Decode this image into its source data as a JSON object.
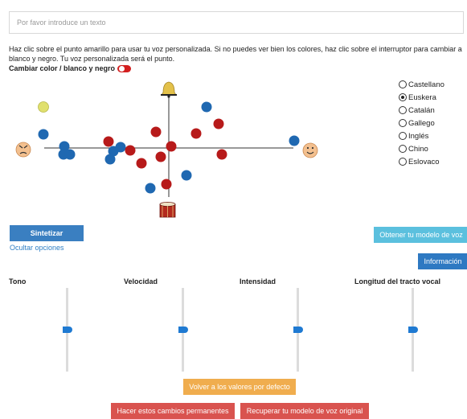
{
  "input": {
    "placeholder": "Por favor introduce un texto",
    "value": ""
  },
  "instructions": "Haz clic sobre el punto amarillo para usar tu voz personalizada. Si no puedes ver bien los colores, haz clic sobre el interruptor para cambiar a blanco y negro. Tu voz personalizada será el punto.",
  "toggle": {
    "label": "Cambiar color / blanco y negro",
    "state": "on"
  },
  "colors": {
    "blue_dot": "#1f68b1",
    "red_dot": "#b71a1a",
    "yellow_dot": "#e0e06e",
    "primary": "#3a7fc1",
    "info": "#5bc0de",
    "warning": "#f0ad4e",
    "danger": "#d9534f"
  },
  "languages": [
    {
      "label": "Castellano",
      "selected": false
    },
    {
      "label": "Euskera",
      "selected": true
    },
    {
      "label": "Catalán",
      "selected": false
    },
    {
      "label": "Gallego",
      "selected": false
    },
    {
      "label": "Inglés",
      "selected": false
    },
    {
      "label": "Chino",
      "selected": false
    },
    {
      "label": "Eslovaco",
      "selected": false
    }
  ],
  "buttons": {
    "synthesize": "Sintetizar",
    "hide_options": "Ocultar opciones",
    "obtain_model": "Obtener tu modelo de voz",
    "info": "Información",
    "reset": "Volver a los valores por defecto",
    "permanent": "Hacer estos cambios permanentes",
    "restore": "Recuperar tu modelo de voz original"
  },
  "sliders": [
    {
      "label": "Tono",
      "value": 0.5
    },
    {
      "label": "Velocidad",
      "value": 0.5
    },
    {
      "label": "Intensidad",
      "value": 0.5
    },
    {
      "label": "Longitud del tracto vocal",
      "value": 0.5
    }
  ],
  "axis_icons": [
    "bell-icon",
    "drum-icon",
    "angry-face-icon",
    "smiley-face-icon"
  ]
}
